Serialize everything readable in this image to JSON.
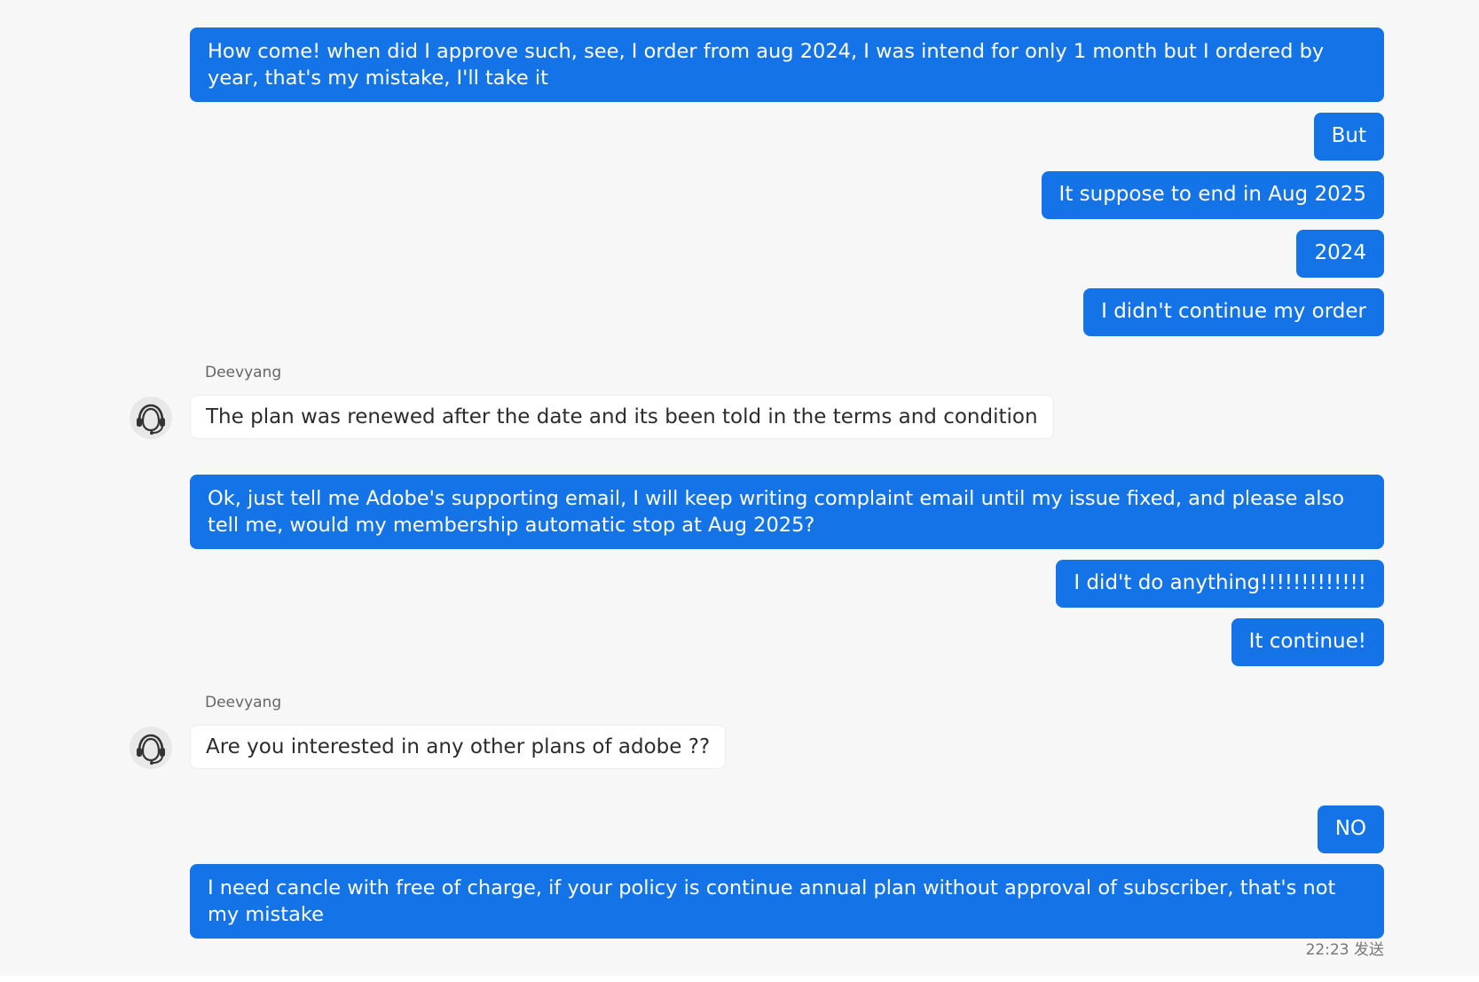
{
  "conversation": {
    "agent_name": "Deevyang",
    "messages": [
      {
        "sender": "user",
        "text": "How come! when did I approve such, see, I order from aug 2024, I was intend for only 1 month but I ordered by year, that's my mistake, I'll take it"
      },
      {
        "sender": "user",
        "text": "But"
      },
      {
        "sender": "user",
        "text": "It suppose to end in Aug 2025"
      },
      {
        "sender": "user",
        "text": "2024"
      },
      {
        "sender": "user",
        "text": "I didn't continue my order"
      },
      {
        "sender": "agent",
        "name": "Deevyang",
        "text": "The plan was renewed after the date and its been told in the terms and condition"
      },
      {
        "sender": "user",
        "text": "Ok, just tell me Adobe's supporting email, I will keep writing complaint email until my issue fixed, and please also tell me, would my membership automatic stop at Aug 2025?"
      },
      {
        "sender": "user",
        "text": "I did't do anything!!!!!!!!!!!!!"
      },
      {
        "sender": "user",
        "text": "It continue!"
      },
      {
        "sender": "agent",
        "name": "Deevyang",
        "text": "Are you interested in any other plans of adobe ??"
      },
      {
        "sender": "user",
        "text": "NO"
      },
      {
        "sender": "user",
        "text": "I need cancle with free of charge, if your policy is continue annual plan without approval of subscriber, that's not my mistake"
      }
    ],
    "last_message_meta": "22:23 发送"
  },
  "colors": {
    "user_bubble": "#1473e6",
    "agent_bubble": "#ffffff",
    "background": "#f7f7f7"
  },
  "icons": {
    "agent_avatar": "headset-icon"
  }
}
